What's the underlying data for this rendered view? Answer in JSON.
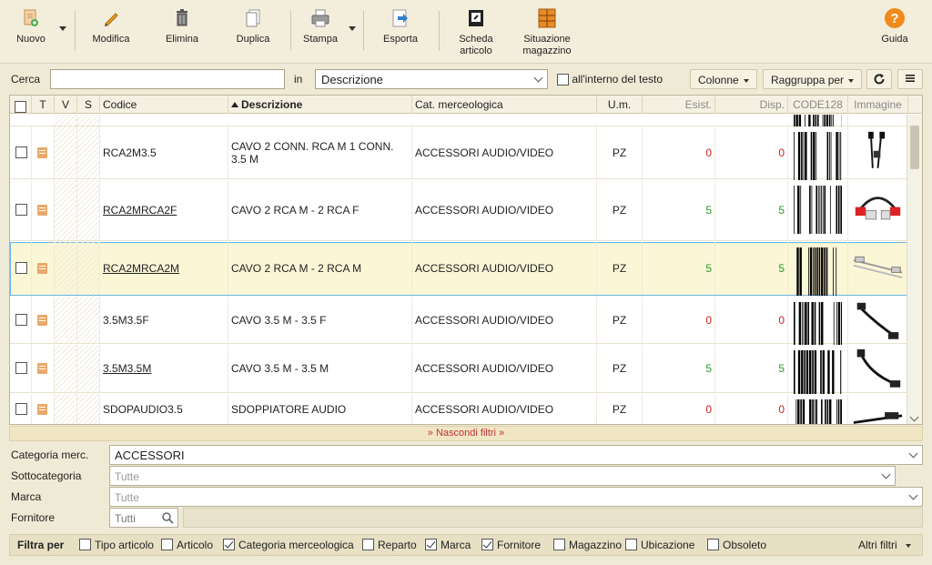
{
  "toolbar": {
    "nuovo": "Nuovo",
    "modifica": "Modifica",
    "elimina": "Elimina",
    "duplica": "Duplica",
    "stampa": "Stampa",
    "esporta": "Esporta",
    "scheda_line1": "Scheda",
    "scheda_line2": "articolo",
    "situazione_line1": "Situazione",
    "situazione_line2": "magazzino",
    "guida": "Guida"
  },
  "search": {
    "label": "Cerca",
    "value": "",
    "in_label": "in",
    "field": "Descrizione",
    "inside_text_label": "all'interno del testo",
    "columns_button": "Colonne",
    "group_button": "Raggruppa per"
  },
  "columns": {
    "t": "T",
    "v": "V",
    "s": "S",
    "codice": "Codice",
    "descrizione": "Descrizione",
    "cat": "Cat. merceologica",
    "um": "U.m.",
    "esist": "Esist.",
    "disp": "Disp.",
    "code128": "CODE128",
    "immagine": "Immagine"
  },
  "rows": [
    {
      "code": "RCA2M3.5",
      "desc": "CAVO 2 CONN. RCA M 1 CONN. 3.5 M",
      "cat": "ACCESSORI AUDIO/VIDEO",
      "um": "PZ",
      "esist": "0",
      "disp": "0",
      "status": "red",
      "underline": false
    },
    {
      "code": "RCA2MRCA2F",
      "desc": "CAVO 2 RCA M - 2 RCA F",
      "cat": "ACCESSORI AUDIO/VIDEO",
      "um": "PZ",
      "esist": "5",
      "disp": "5",
      "status": "green",
      "underline": true
    },
    {
      "code": "RCA2MRCA2M",
      "desc": "CAVO 2 RCA M - 2 RCA M",
      "cat": "ACCESSORI AUDIO/VIDEO",
      "um": "PZ",
      "esist": "5",
      "disp": "5",
      "status": "green",
      "underline": true
    },
    {
      "code": "3.5M3.5F",
      "desc": "CAVO 3.5 M - 3.5 F",
      "cat": "ACCESSORI AUDIO/VIDEO",
      "um": "PZ",
      "esist": "0",
      "disp": "0",
      "status": "red",
      "underline": false
    },
    {
      "code": "3.5M3.5M",
      "desc": "CAVO 3.5 M - 3.5 M",
      "cat": "ACCESSORI AUDIO/VIDEO",
      "um": "PZ",
      "esist": "5",
      "disp": "5",
      "status": "green",
      "underline": true
    },
    {
      "code": "SDOPAUDIO3.5",
      "desc": "SDOPPIATORE AUDIO",
      "cat": "ACCESSORI AUDIO/VIDEO",
      "um": "PZ",
      "esist": "0",
      "disp": "0",
      "status": "red",
      "underline": false
    }
  ],
  "hide_filters": "Nascondi filtri",
  "filters": {
    "categoria_label": "Categoria merc.",
    "categoria_value": "ACCESSORI",
    "sottocategoria_label": "Sottocategoria",
    "sottocategoria_value": "Tutte",
    "marca_label": "Marca",
    "marca_value": "Tutte",
    "fornitore_label": "Fornitore",
    "fornitore_value": "Tutti"
  },
  "filter_by": {
    "label": "Filtra per",
    "items": [
      {
        "label": "Tipo articolo",
        "checked": false
      },
      {
        "label": "Articolo",
        "checked": false
      },
      {
        "label": "Categoria merceologica",
        "checked": true
      },
      {
        "label": "Reparto",
        "checked": false
      },
      {
        "label": "Marca",
        "checked": true
      },
      {
        "label": "Fornitore",
        "checked": true
      },
      {
        "label": "Magazzino",
        "checked": false
      },
      {
        "label": "Ubicazione",
        "checked": false
      },
      {
        "label": "Obsoleto",
        "checked": false
      }
    ],
    "more": "Altri filtri"
  },
  "colors": {
    "accent_orange": "#f0a020",
    "selected_row": "#fbf7d6",
    "status_red": "#cc2222",
    "status_green": "#2a9a2a"
  }
}
